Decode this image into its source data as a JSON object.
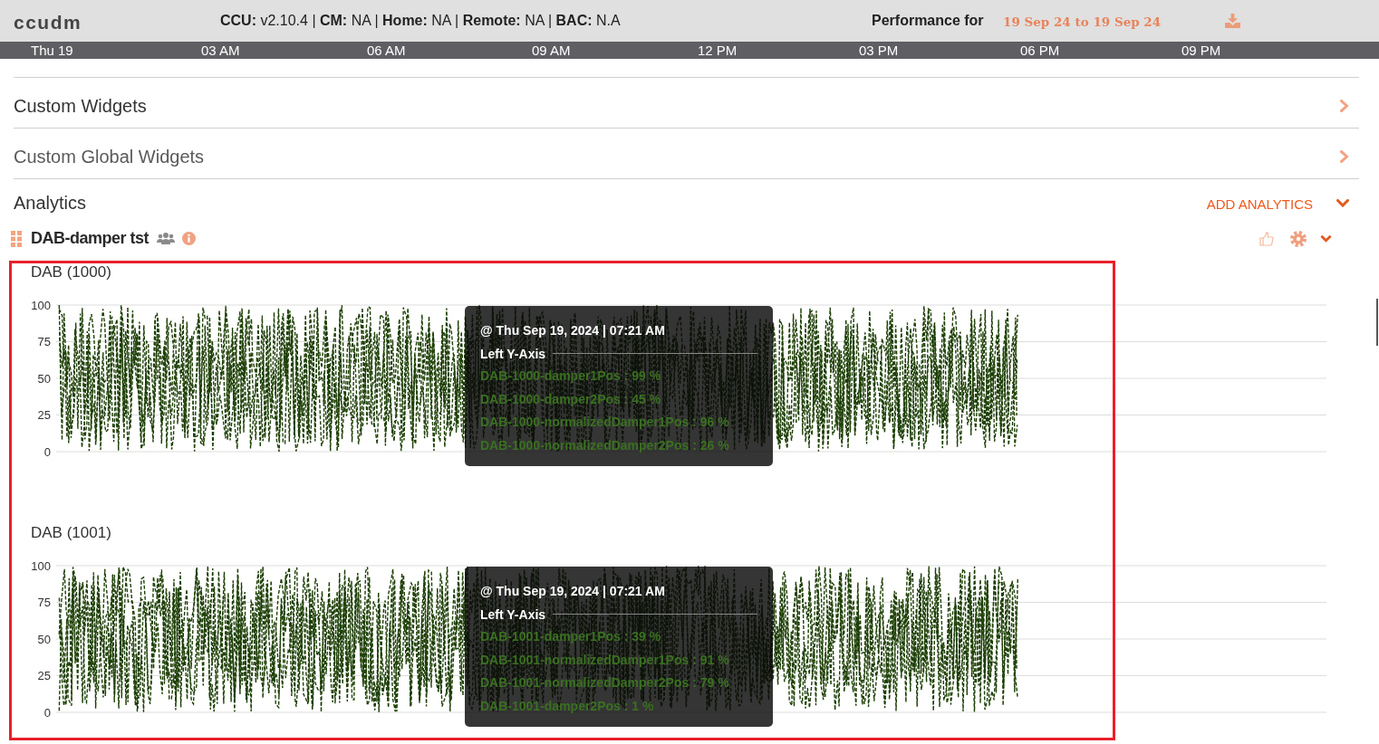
{
  "header": {
    "brand": "ccudm",
    "info": "**CCU:** v2.10.4 | **CM:** NA | **Home:** NA | **Remote:** NA | **BAC:** N.A",
    "performance_label": "Performance for",
    "date_range": "19 Sep 24 to 19 Sep 24"
  },
  "time_axis": {
    "labels": [
      "Thu 19",
      "03 AM",
      "06 AM",
      "09 AM",
      "12 PM",
      "03 PM",
      "06 PM",
      "09 PM"
    ]
  },
  "sections": [
    {
      "title": "Custom Widgets",
      "expanded": false,
      "muted": false
    },
    {
      "title": "Custom Global Widgets",
      "expanded": false,
      "muted": true
    },
    {
      "title": "Analytics",
      "expanded": true,
      "muted": false,
      "action": "ADD ANALYTICS"
    }
  ],
  "widget": {
    "title": "DAB-damper tst",
    "expanded": true,
    "charts": [
      {
        "title": "DAB (1000)",
        "y_tick_labels": [
          "100",
          "75",
          "50",
          "25",
          "0"
        ],
        "tooltip": {
          "timestamp": "@ Thu Sep 19, 2024 | 07:21 AM",
          "axis_label": "Left Y-Axis",
          "entries": [
            "DAB-1000-damper1Pos : 99 %",
            "DAB-1000-damper2Pos : 45 %",
            "DAB-1000-normalizedDamper1Pos : 96 %",
            "DAB-1000-normalizedDamper2Pos : 26 %"
          ]
        }
      },
      {
        "title": "DAB (1001)",
        "y_tick_labels": [
          "100",
          "75",
          "50",
          "25",
          "0"
        ],
        "tooltip": {
          "timestamp": "@ Thu Sep 19, 2024 | 07:21 AM",
          "axis_label": "Left Y-Axis",
          "entries": [
            "DAB-1001-damper1Pos : 39 %",
            "DAB-1001-normalizedDamper1Pos : 91 %",
            "DAB-1001-normalizedDamper2Pos : 79 %",
            "DAB-1001-damper2Pos : 1 %"
          ]
        }
      }
    ]
  }
}
